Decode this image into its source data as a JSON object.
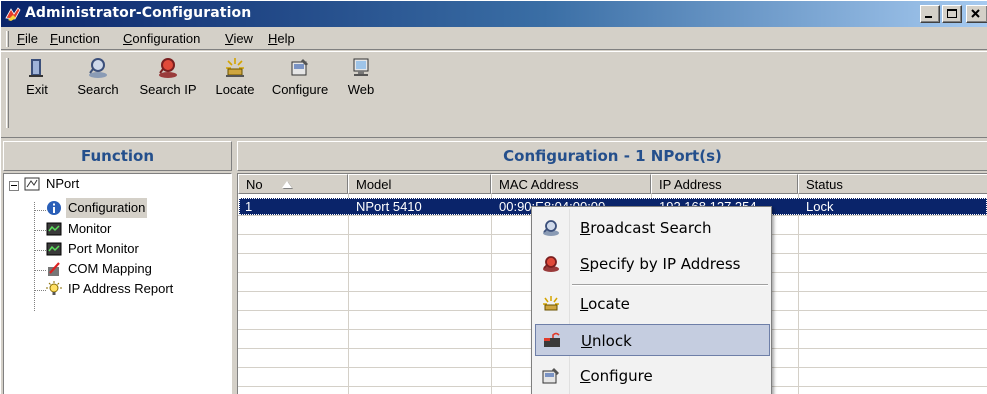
{
  "window": {
    "title": "Administrator-Configuration"
  },
  "menu": [
    {
      "label": "File",
      "hot": "F",
      "rest": "ile"
    },
    {
      "label": "Function",
      "hot": "F",
      "rest": "unction"
    },
    {
      "label": "Configuration",
      "hot": "C",
      "rest": "onfiguration"
    },
    {
      "label": "View",
      "hot": "V",
      "rest": "iew"
    },
    {
      "label": "Help",
      "hot": "H",
      "rest": "elp"
    }
  ],
  "toolbar": [
    {
      "label": "Exit",
      "icon": "exit-icon"
    },
    {
      "label": "Search",
      "icon": "search-icon"
    },
    {
      "label": "Search IP",
      "icon": "search-ip-icon"
    },
    {
      "label": "Locate",
      "icon": "locate-icon"
    },
    {
      "label": "Configure",
      "icon": "configure-icon"
    },
    {
      "label": "Web",
      "icon": "web-icon"
    }
  ],
  "function_panel": {
    "header": "Function",
    "root": "NPort",
    "items": [
      "Configuration",
      "Monitor",
      "Port Monitor",
      "COM Mapping",
      "IP Address Report"
    ],
    "selected": "Configuration"
  },
  "config_panel": {
    "header": "Configuration - 1 NPort(s)",
    "columns": [
      "No",
      "Model",
      "MAC Address",
      "IP Address",
      "Status"
    ],
    "rows": [
      {
        "no": "1",
        "model": "NPort 5410",
        "mac": "00:90:E8:04:00:00",
        "ip": "192.168.127.254",
        "status": "Lock"
      }
    ]
  },
  "context_menu": {
    "items": [
      {
        "hot": "B",
        "rest": "roadcast Search",
        "icon": "broadcast-search-icon"
      },
      {
        "hot": "S",
        "rest": "pecify by IP Address",
        "icon": "specify-ip-icon"
      },
      {
        "hot": "L",
        "rest": "ocate",
        "icon": "locate-icon"
      },
      {
        "hot": "U",
        "rest": "nlock",
        "icon": "unlock-icon",
        "highlighted": true
      },
      {
        "hot": "C",
        "rest": "onfigure",
        "icon": "configure-icon"
      }
    ]
  },
  "colors": {
    "title_gradient_start": "#0a246a",
    "panel_header_text": "#244f8c",
    "selection": "#0a246a",
    "menu_highlight": "#c5cde0"
  }
}
